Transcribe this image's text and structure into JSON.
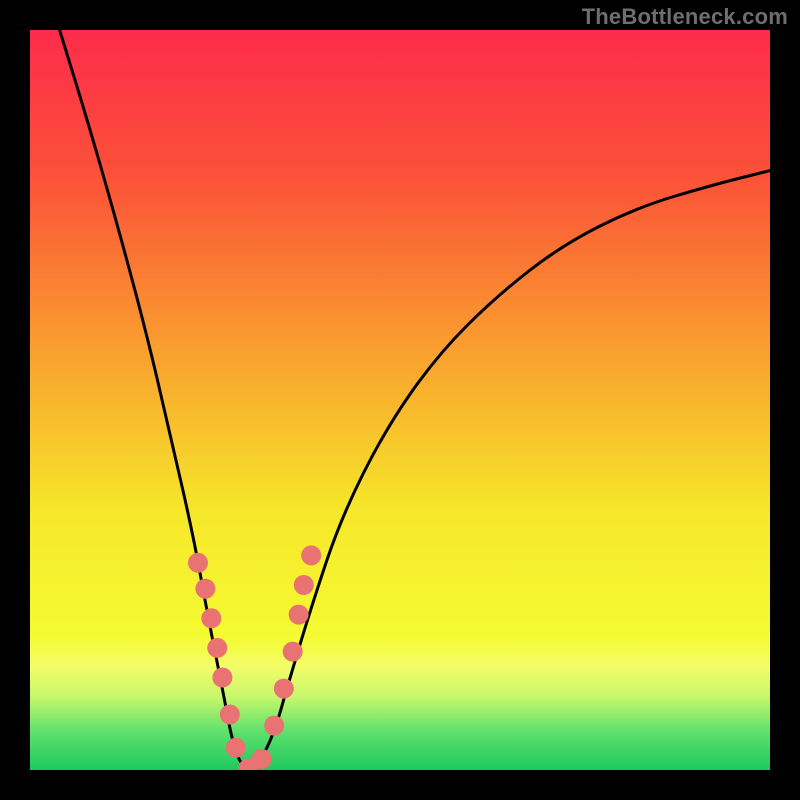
{
  "watermark": "TheBottleneck.com",
  "colors": {
    "gradient_stops": [
      {
        "offset": 0.0,
        "color": "#fd2b4b"
      },
      {
        "offset": 0.2,
        "color": "#fb5238"
      },
      {
        "offset": 0.45,
        "color": "#f9a52e"
      },
      {
        "offset": 0.65,
        "color": "#f6e72a"
      },
      {
        "offset": 0.82,
        "color": "#f5fb32"
      },
      {
        "offset": 0.86,
        "color": "#f3fd6a"
      },
      {
        "offset": 0.9,
        "color": "#c9f76b"
      },
      {
        "offset": 0.95,
        "color": "#5ce06c"
      },
      {
        "offset": 1.0,
        "color": "#1ec95f"
      }
    ],
    "curve": "#000000",
    "marker": "#e97373",
    "frame": "#000000"
  },
  "chart_data": {
    "type": "line",
    "title": "",
    "xlabel": "",
    "ylabel": "",
    "xlim": [
      0,
      100
    ],
    "ylim": [
      0,
      100
    ],
    "grid": false,
    "notes": "Axes are unlabeled; x and y values are estimated pixel-normalized to 0-100. Curve is a V / bottleneck shape with minimum (~0) around x≈27-32. Left branch is steep, right branch rises with decreasing slope.",
    "series": [
      {
        "name": "bottleneck-curve",
        "x": [
          4,
          8,
          12,
          16,
          19,
          22,
          24,
          26,
          27.5,
          29,
          31,
          33,
          35,
          38,
          42,
          48,
          55,
          63,
          72,
          82,
          92,
          100
        ],
        "y": [
          100,
          87,
          73,
          58,
          45,
          32,
          21,
          11,
          3,
          0,
          1,
          5,
          12,
          22,
          34,
          46,
          56,
          64,
          71,
          76,
          79,
          81
        ]
      },
      {
        "name": "salmon-markers",
        "type": "scatter",
        "marker_radius_px": 10,
        "x": [
          22.7,
          23.7,
          24.5,
          25.3,
          26.0,
          27.0,
          27.8,
          29.5,
          31.3,
          33.0,
          34.3,
          35.5,
          36.3,
          37.0,
          38.0
        ],
        "y": [
          28.0,
          24.5,
          20.5,
          16.5,
          12.5,
          7.5,
          3.0,
          0.2,
          1.5,
          6.0,
          11.0,
          16.0,
          21.0,
          25.0,
          29.0
        ]
      }
    ]
  }
}
